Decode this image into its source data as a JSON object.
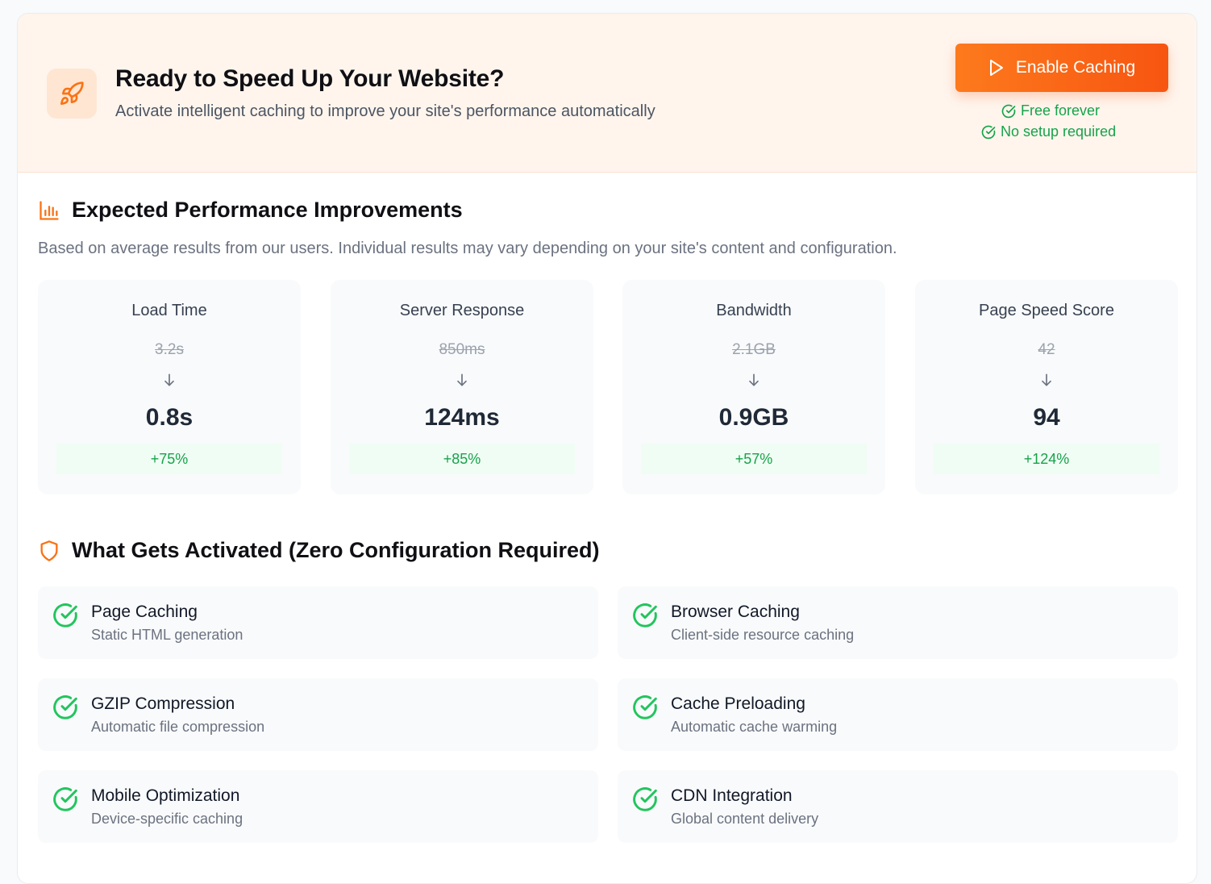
{
  "hero": {
    "title": "Ready to Speed Up Your Website?",
    "subtitle": "Activate intelligent caching to improve your site's performance automatically",
    "icon": "rocket-icon",
    "cta_label": "Enable Caching",
    "perks": [
      "Free forever",
      "No setup required"
    ]
  },
  "performance": {
    "title": "Expected Performance Improvements",
    "description": "Based on average results from our users. Individual results may vary depending on your site's content and configuration.",
    "metrics": [
      {
        "label": "Load Time",
        "before": "3.2s",
        "after": "0.8s",
        "gain": "+75%"
      },
      {
        "label": "Server Response",
        "before": "850ms",
        "after": "124ms",
        "gain": "+85%"
      },
      {
        "label": "Bandwidth",
        "before": "2.1GB",
        "after": "0.9GB",
        "gain": "+57%"
      },
      {
        "label": "Page Speed Score",
        "before": "42",
        "after": "94",
        "gain": "+124%"
      }
    ]
  },
  "features": {
    "title": "What Gets Activated (Zero Configuration Required)",
    "items": [
      {
        "title": "Page Caching",
        "desc": "Static HTML generation"
      },
      {
        "title": "Browser Caching",
        "desc": "Client-side resource caching"
      },
      {
        "title": "GZIP Compression",
        "desc": "Automatic file compression"
      },
      {
        "title": "Cache Preloading",
        "desc": "Automatic cache warming"
      },
      {
        "title": "Mobile Optimization",
        "desc": "Device-specific caching"
      },
      {
        "title": "CDN Integration",
        "desc": "Global content delivery"
      }
    ]
  },
  "colors": {
    "accent": "#f97316",
    "success": "#16a34a",
    "hero_bg": "#fff5ed"
  }
}
